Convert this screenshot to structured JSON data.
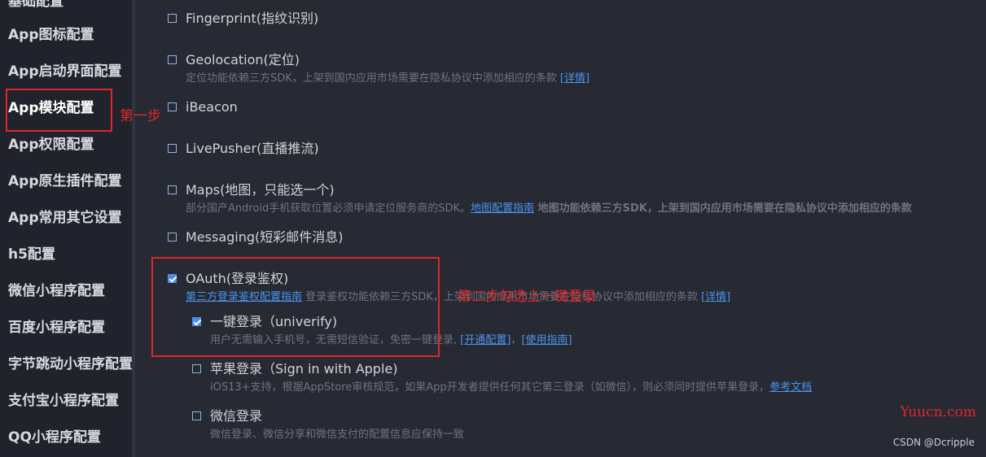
{
  "sidebar": {
    "items": [
      {
        "label": "基础配置"
      },
      {
        "label": "App图标配置"
      },
      {
        "label": "App启动界面配置"
      },
      {
        "label": "App模块配置"
      },
      {
        "label": "App权限配置"
      },
      {
        "label": "App原生插件配置"
      },
      {
        "label": "App常用其它设置"
      },
      {
        "label": "h5配置"
      },
      {
        "label": "微信小程序配置"
      },
      {
        "label": "百度小程序配置"
      },
      {
        "label": "字节跳动小程序配置"
      },
      {
        "label": "支付宝小程序配置"
      },
      {
        "label": "QQ小程序配置"
      }
    ],
    "active_index": 3
  },
  "modules": {
    "fingerprint": {
      "title": "Fingerprint(指纹识别)",
      "checked": false
    },
    "geolocation": {
      "title": "Geolocation(定位)",
      "checked": false,
      "desc": "定位功能依赖三方SDK，上架到国内应用市场需要在隐私协议中添加相应的条款 ",
      "link": "[详情]"
    },
    "ibeacon": {
      "title": "iBeacon",
      "checked": false
    },
    "livepusher": {
      "title": "LivePusher(直播推流)",
      "checked": false
    },
    "maps": {
      "title": "Maps(地图，只能选一个)",
      "checked": false,
      "desc_a": "部分国产Android手机获取位置必须申请定位服务商的SDK。",
      "link": "地图配置指南",
      "desc_b": " 地图功能依赖三方SDK，上架到国内应用市场需要在隐私协议中添加相应的条款"
    },
    "messaging": {
      "title": "Messaging(短彩邮件消息)",
      "checked": false
    },
    "oauth": {
      "title": "OAuth(登录鉴权)",
      "checked": true,
      "link": "第三方登录鉴权配置指南",
      "desc": " 登录鉴权功能依赖三方SDK，上架到国内应用市场需要在隐私协议中添加相应的条款 ",
      "link2": "[详情]",
      "sub": {
        "univerify": {
          "title": "一键登录（univerify)",
          "checked": true,
          "desc": "用户无需输入手机号，无需短信验证，免密一键登录, ",
          "link1": "[开通配置]",
          "sep": "，",
          "link2": "[使用指南]"
        },
        "apple": {
          "title": "苹果登录（Sign in with Apple)",
          "checked": false,
          "desc": "iOS13+支持，根据AppStore审核规范，如果App开发者提供任何其它第三登录（如微信），则必须同时提供苹果登录，",
          "link": "参考文档"
        },
        "weixin": {
          "title": "微信登录",
          "checked": false,
          "desc": "微信登录、微信分享和微信支付的配置信息应保持一致"
        }
      }
    }
  },
  "annotations": {
    "step1": "第一步",
    "step2": "第二步勾选上一键登录"
  },
  "watermarks": {
    "site": "Yuucn.com",
    "csdn": "CSDN @Dcripple"
  },
  "colors": {
    "annotation": "#e0262a",
    "link": "#4a94f0",
    "checkbox_checked": "#4a8ee8"
  }
}
